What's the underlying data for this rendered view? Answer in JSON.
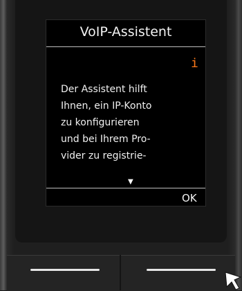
{
  "screen": {
    "title": "VoIP-Assistent",
    "info_icon": "i",
    "lines": [
      "Der Assistent hilft",
      "Ihnen, ein IP-Konto",
      "zu konfigurieren",
      "und bei Ihrem Pro-",
      "vider zu registrie-"
    ],
    "scroll_indicator": "▼",
    "softkey_right": "OK"
  },
  "icons": {
    "info": "info-icon",
    "scroll_down": "scroll-down-icon",
    "pointer": "pointer-arrow-icon"
  },
  "colors": {
    "screen_bg": "#000000",
    "info_accent": "#ff7a1a",
    "text": "#f2f2f2"
  }
}
